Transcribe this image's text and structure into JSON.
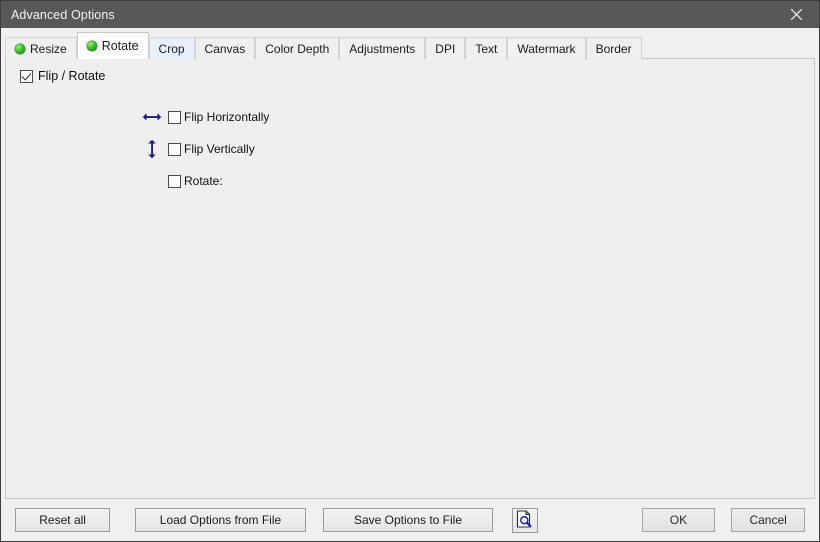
{
  "window": {
    "title": "Advanced Options",
    "close_icon": "close-icon"
  },
  "tabs": [
    {
      "label": "Resize",
      "state": "indicator",
      "indicator": true,
      "active": false
    },
    {
      "label": "Rotate",
      "state": "active",
      "indicator": true,
      "active": true
    },
    {
      "label": "Crop",
      "state": "hover",
      "indicator": false,
      "active": false
    },
    {
      "label": "Canvas",
      "state": "normal",
      "indicator": false,
      "active": false
    },
    {
      "label": "Color Depth",
      "state": "normal",
      "indicator": false,
      "active": false
    },
    {
      "label": "Adjustments",
      "state": "normal",
      "indicator": false,
      "active": false
    },
    {
      "label": "DPI",
      "state": "normal",
      "indicator": false,
      "active": false
    },
    {
      "label": "Text",
      "state": "normal",
      "indicator": false,
      "active": false
    },
    {
      "label": "Watermark",
      "state": "normal",
      "indicator": false,
      "active": false
    },
    {
      "label": "Border",
      "state": "normal",
      "indicator": false,
      "active": false
    }
  ],
  "panel": {
    "master_checkbox": {
      "label": "Flip / Rotate",
      "checked": true
    },
    "options": [
      {
        "label": "Flip Horizontally",
        "checked": false,
        "icon": "arrow-horizontal-icon"
      },
      {
        "label": "Flip Vertically",
        "checked": false,
        "icon": "arrow-vertical-icon"
      },
      {
        "label": "Rotate:",
        "checked": false,
        "icon": "none"
      }
    ]
  },
  "footer": {
    "reset_all": "Reset all",
    "load_options": "Load Options from File",
    "save_options": "Save Options to File",
    "preview_icon": "document-preview-icon",
    "ok": "OK",
    "cancel": "Cancel"
  },
  "colors": {
    "titlebar": "#585858",
    "accent_arrow": "#1b1b8f",
    "tab_active_bg": "#ffffff",
    "tab_hover_bg": "#e8f1fb",
    "panel_bg": "#efefef",
    "indicator_green": "#2fbf1e"
  }
}
